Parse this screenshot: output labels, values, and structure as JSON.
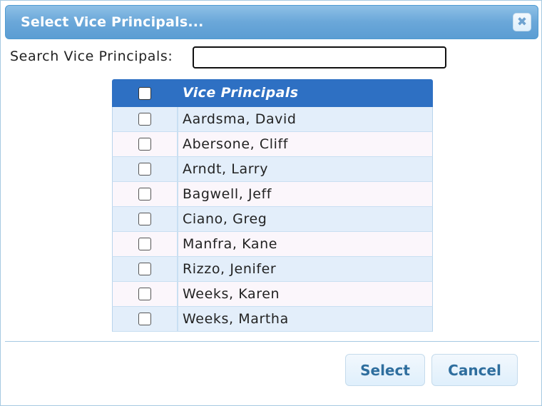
{
  "dialog": {
    "title": "Select Vice Principals...",
    "close_icon": "close-icon"
  },
  "search": {
    "label": "Search Vice Principals:",
    "value": "",
    "placeholder": ""
  },
  "table": {
    "header_label": "Vice Principals",
    "header_checked": false,
    "rows": [
      {
        "name": "Aardsma, David",
        "checked": false
      },
      {
        "name": "Abersone, Cliff",
        "checked": false
      },
      {
        "name": "Arndt, Larry",
        "checked": false
      },
      {
        "name": "Bagwell, Jeff",
        "checked": false
      },
      {
        "name": "Ciano, Greg",
        "checked": false
      },
      {
        "name": "Manfra, Kane",
        "checked": false
      },
      {
        "name": "Rizzo, Jenifer",
        "checked": false
      },
      {
        "name": "Weeks, Karen",
        "checked": false
      },
      {
        "name": "Weeks, Martha",
        "checked": false
      }
    ]
  },
  "buttons": {
    "select_label": "Select",
    "cancel_label": "Cancel"
  },
  "colors": {
    "titlebar": "#6aa7d9",
    "header": "#2e70c3",
    "row_odd": "#e3eefa",
    "row_even": "#fbf6fb",
    "button_text": "#2e6e9e"
  }
}
